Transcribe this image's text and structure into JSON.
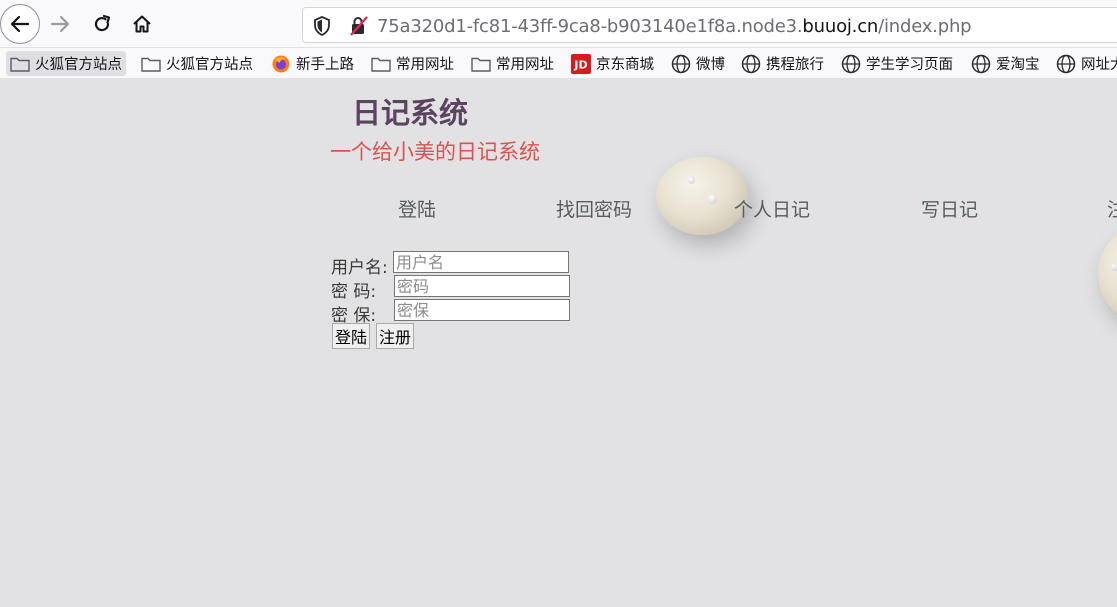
{
  "browser": {
    "url_prefix": "75a320d1-fc81-43ff-9ca8-b903140e1f8a.node3.",
    "url_host": "buuoj.cn",
    "url_path": "/index.php"
  },
  "bookmarks": [
    {
      "label": "火狐官方站点",
      "icon": "folder-icon"
    },
    {
      "label": "火狐官方站点",
      "icon": "folder-icon"
    },
    {
      "label": "新手上路",
      "icon": "firefox-icon"
    },
    {
      "label": "常用网址",
      "icon": "folder-icon"
    },
    {
      "label": "常用网址",
      "icon": "folder-icon"
    },
    {
      "label": "京东商城",
      "icon": "jd-icon"
    },
    {
      "label": "微博",
      "icon": "globe-icon"
    },
    {
      "label": "携程旅行",
      "icon": "globe-icon"
    },
    {
      "label": "学生学习页面",
      "icon": "globe-icon"
    },
    {
      "label": "爱淘宝",
      "icon": "globe-icon"
    },
    {
      "label": "网址大",
      "icon": "globe-icon"
    }
  ],
  "site": {
    "title": "日记系统",
    "subtitle": "一个给小美的日记系统",
    "menu": [
      "登陆",
      "找回密码",
      "个人日记",
      "写日记",
      "注"
    ]
  },
  "login_form": {
    "username_label": "用户名:",
    "username_placeholder": "用户名",
    "password_label": "密 码:",
    "password_placeholder": "密码",
    "security_label": "密 保:",
    "security_placeholder": "密保",
    "login_button": "登陆",
    "register_button": "注册"
  },
  "colors": {
    "title": "#5a4460",
    "subtitle": "#d9534f",
    "menu": "#555d63",
    "background": "#e2e2e4"
  }
}
